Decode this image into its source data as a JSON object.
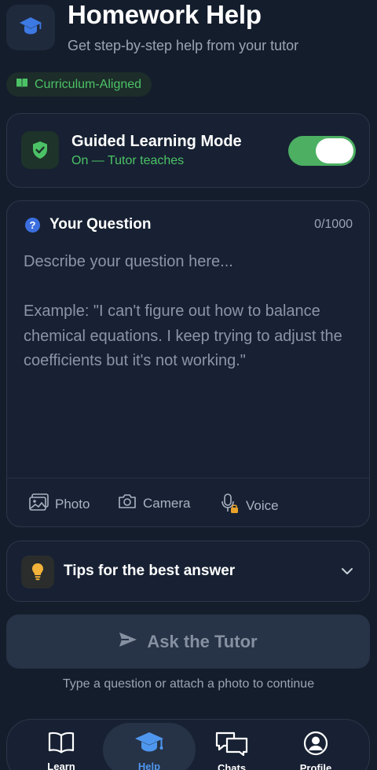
{
  "header": {
    "title": "Homework Help",
    "subtitle": "Get step-by-step help from your tutor",
    "icon": "graduation-cap-icon"
  },
  "badge": {
    "label": "Curriculum-Aligned",
    "icon": "book-icon",
    "color": "#4cc266"
  },
  "guided_mode": {
    "title": "Guided Learning Mode",
    "status": "On — Tutor teaches",
    "enabled": true,
    "icon": "shield-check-icon"
  },
  "question": {
    "title": "Your Question",
    "counter": "0/1000",
    "value": "",
    "placeholder": "Describe your question here...\n\nExample: \"I can't figure out how to balance chemical equations. I keep trying to adjust the coefficients but it's not working.\"",
    "attachments": [
      {
        "label": "Photo",
        "icon": "image-icon"
      },
      {
        "label": "Camera",
        "icon": "camera-icon"
      },
      {
        "label": "Voice",
        "icon": "microphone-locked-icon"
      }
    ]
  },
  "tips": {
    "title": "Tips for the best answer",
    "icon": "lightbulb-icon",
    "expanded": false
  },
  "ask_button": {
    "label": "Ask the Tutor",
    "icon": "send-icon",
    "disabled": true
  },
  "hint": "Type a question or attach a photo to continue",
  "nav": {
    "items": [
      {
        "label": "Learn",
        "icon": "book-open-icon",
        "active": false
      },
      {
        "label": "Help",
        "icon": "graduation-cap-icon",
        "active": true
      },
      {
        "label": "Chats",
        "icon": "chat-bubbles-icon",
        "active": false
      },
      {
        "label": "Profile",
        "icon": "user-circle-icon",
        "active": false
      }
    ]
  },
  "colors": {
    "background": "#141d2c",
    "card": "#172133",
    "accent_green": "#4caf62",
    "accent_blue": "#4f97ee"
  }
}
